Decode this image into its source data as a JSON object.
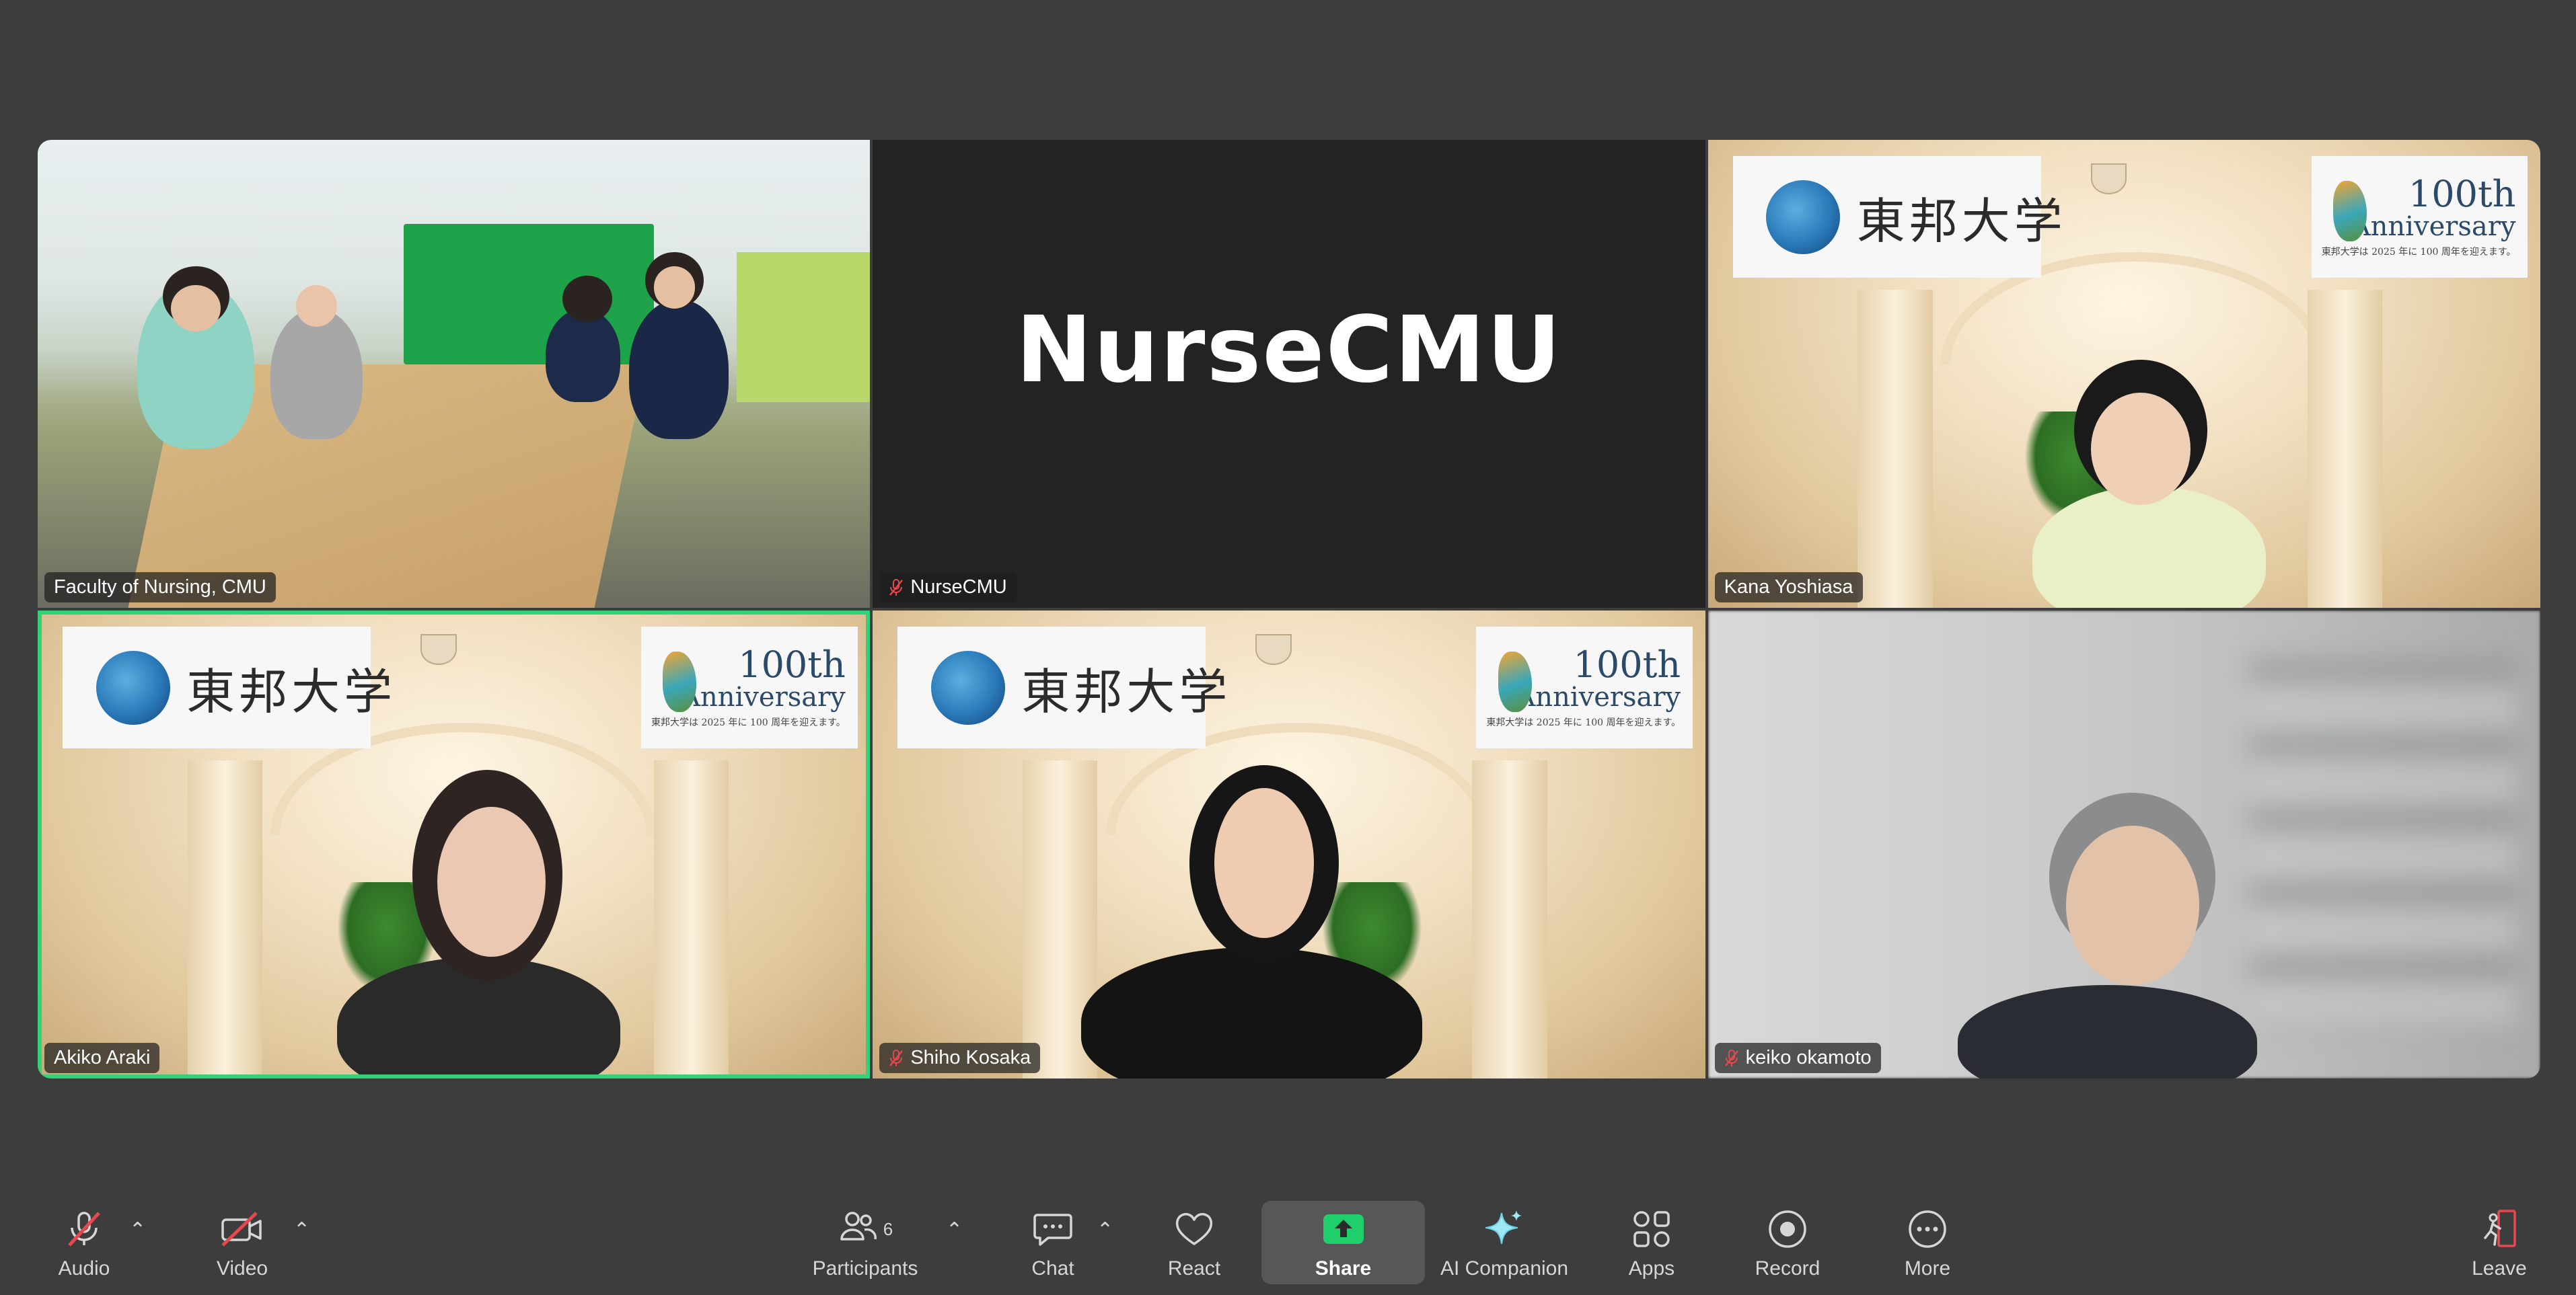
{
  "tiles": [
    {
      "name": "Faculty of Nursing, CMU",
      "muted": false,
      "kind": "room"
    },
    {
      "name": "NurseCMU",
      "muted": true,
      "kind": "text",
      "display_text": "NurseCMU"
    },
    {
      "name": "Kana Yoshiasa",
      "muted": false,
      "kind": "hall"
    },
    {
      "name": "Akiko Araki",
      "muted": false,
      "kind": "hall",
      "speaking": true
    },
    {
      "name": "Shiho Kosaka",
      "muted": true,
      "kind": "hall"
    },
    {
      "name": "keiko okamoto",
      "muted": true,
      "kind": "blur"
    }
  ],
  "banner": {
    "logo_text": "東邦大学",
    "anniv_line1": "100th",
    "anniv_line2": "Anniversary",
    "anniv_small": "東邦大学は 2025 年に 100 周年を迎えます。"
  },
  "toolbar": {
    "audio_label": "Audio",
    "video_label": "Video",
    "participants_label": "Participants",
    "participants_count": "6",
    "chat_label": "Chat",
    "react_label": "React",
    "share_label": "Share",
    "ai_label": "AI Companion",
    "apps_label": "Apps",
    "record_label": "Record",
    "more_label": "More",
    "leave_label": "Leave"
  },
  "colors": {
    "background": "#3d3d3d",
    "speaking_border": "#33d17a",
    "share_green": "#1fcf6b",
    "muted_red": "#e5484d"
  }
}
